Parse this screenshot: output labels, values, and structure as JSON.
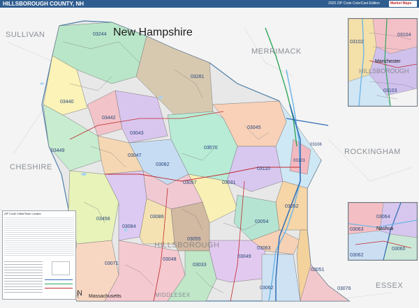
{
  "title": "HILLSBOROUGH COUNTY, NH",
  "edition": "2020 ZIP Code ColorCast Edition",
  "publisher_logo": "Market Maps",
  "state_label": "New Hampshire",
  "county_overlay_label": "HILLSBOROUGH",
  "neighbor_counties": {
    "sullivan": "SULLIVAN",
    "merrimack": "MERRIMACK",
    "cheshire": "CHESHIRE",
    "rockingham": "ROCKINGHAM",
    "middlesex": "MIDDLESEX",
    "essex": "ESSEX",
    "massachusetts_state": "Massachusetts",
    "edge_label": "ER"
  },
  "zip_codes": [
    {
      "code": "03244"
    },
    {
      "code": "03281"
    },
    {
      "code": "03440"
    },
    {
      "code": "03442"
    },
    {
      "code": "03043"
    },
    {
      "code": "03045"
    },
    {
      "code": "03449"
    },
    {
      "code": "03047"
    },
    {
      "code": "03070"
    },
    {
      "code": "03082"
    },
    {
      "code": "03057"
    },
    {
      "code": "03031"
    },
    {
      "code": "03110"
    },
    {
      "code": "03458"
    },
    {
      "code": "03084"
    },
    {
      "code": "03086"
    },
    {
      "code": "03052"
    },
    {
      "code": "03054"
    },
    {
      "code": "03055"
    },
    {
      "code": "03071"
    },
    {
      "code": "03048"
    },
    {
      "code": "03033"
    },
    {
      "code": "03049"
    },
    {
      "code": "03063"
    },
    {
      "code": "03062"
    },
    {
      "code": "03051"
    },
    {
      "code": "03076"
    },
    {
      "code": "03103"
    },
    {
      "code": "03106"
    }
  ],
  "inset_north": {
    "city": "Manchester",
    "zips": [
      "03102",
      "03104",
      "03103"
    ],
    "county": "HILLSBOROUGH"
  },
  "inset_south": {
    "city": "Nashua",
    "zips": [
      "03064",
      "03063",
      "03062",
      "03060"
    ]
  },
  "legend": {
    "title": "ZIP Code Cities/Town Locator"
  },
  "compass": "N",
  "colors": {
    "title_bar": "#2f5d8f",
    "county_border": "#4b7fa8",
    "interstate": "#2f6db5",
    "state_route": "#c0282d",
    "highway_green": "#2fa85a"
  }
}
